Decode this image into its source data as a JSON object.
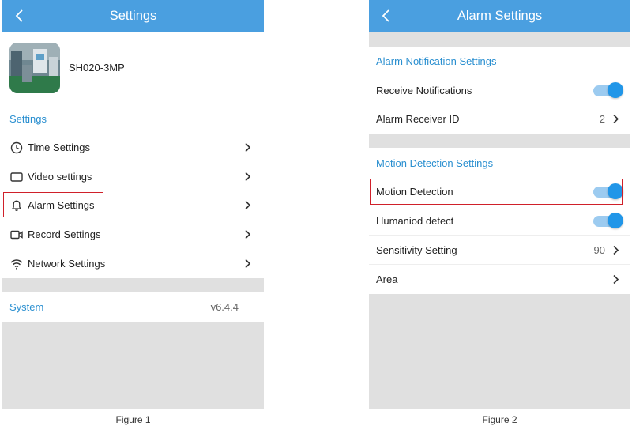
{
  "figure1": {
    "header": {
      "title": "Settings"
    },
    "device": {
      "name": "SH020-3MP"
    },
    "settings_section_label": "Settings",
    "items": [
      {
        "label": "Time Settings",
        "icon": "clock-icon"
      },
      {
        "label": "Video settings",
        "icon": "video-rect-icon"
      },
      {
        "label": "Alarm Settings",
        "icon": "bell-icon",
        "highlighted": true
      },
      {
        "label": "Record Settings",
        "icon": "video-camera-icon"
      },
      {
        "label": "Network Settings",
        "icon": "wifi-icon"
      }
    ],
    "system": {
      "label": "System",
      "version": "v6.4.4"
    },
    "caption": "Figure 1"
  },
  "figure2": {
    "header": {
      "title": "Alarm Settings"
    },
    "notification_section_label": "Alarm Notification Settings",
    "notification_items": [
      {
        "label": "Receive Notifications",
        "toggle": true
      },
      {
        "label": "Alarm Receiver ID",
        "value": "2"
      }
    ],
    "motion_section_label": "Motion Detection Settings",
    "motion_items": [
      {
        "label": "Motion Detection",
        "toggle": true,
        "highlighted": true
      },
      {
        "label": "Humaniod detect",
        "toggle": true
      },
      {
        "label": "Sensitivity Setting",
        "value": "90"
      },
      {
        "label": "Area"
      }
    ],
    "caption": "Figure 2"
  },
  "colors": {
    "header": "#4a9fe0",
    "accent": "#2a8fd0",
    "toggle_on": "#2196e8",
    "highlight": "#d0202a",
    "background": "#e0e0e0"
  }
}
